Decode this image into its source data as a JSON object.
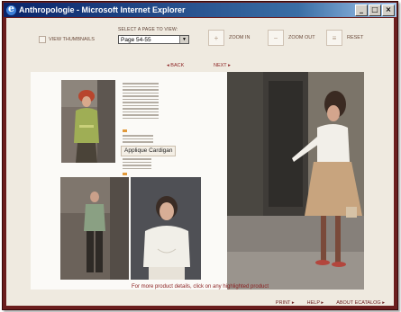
{
  "window": {
    "title": "Anthropologie - Microsoft Internet Explorer",
    "buttons": [
      "_",
      "□",
      "×"
    ]
  },
  "toolbar": {
    "view_thumbnails": "VIEW THUMBNAILS",
    "select_label": "SELECT A PAGE TO VIEW:",
    "page_value": "Page 54-55",
    "zoom_in": "ZOOM IN",
    "zoom_out": "ZOOM OUT",
    "reset": "RESET"
  },
  "nav": {
    "back": "◂ BACK",
    "next": "NEXT ▸"
  },
  "catalog": {
    "highlight_label": "Applique Cardigan"
  },
  "footer": {
    "message": "For more product details, click on any highlighted product",
    "print": "PRINT ▸",
    "help": "HELP ▸",
    "about": "ABOUT ECATALOG ▸"
  },
  "colors": {
    "frame": "#6b1e1e",
    "background": "#efeae0",
    "accent": "#8a1f1f"
  }
}
